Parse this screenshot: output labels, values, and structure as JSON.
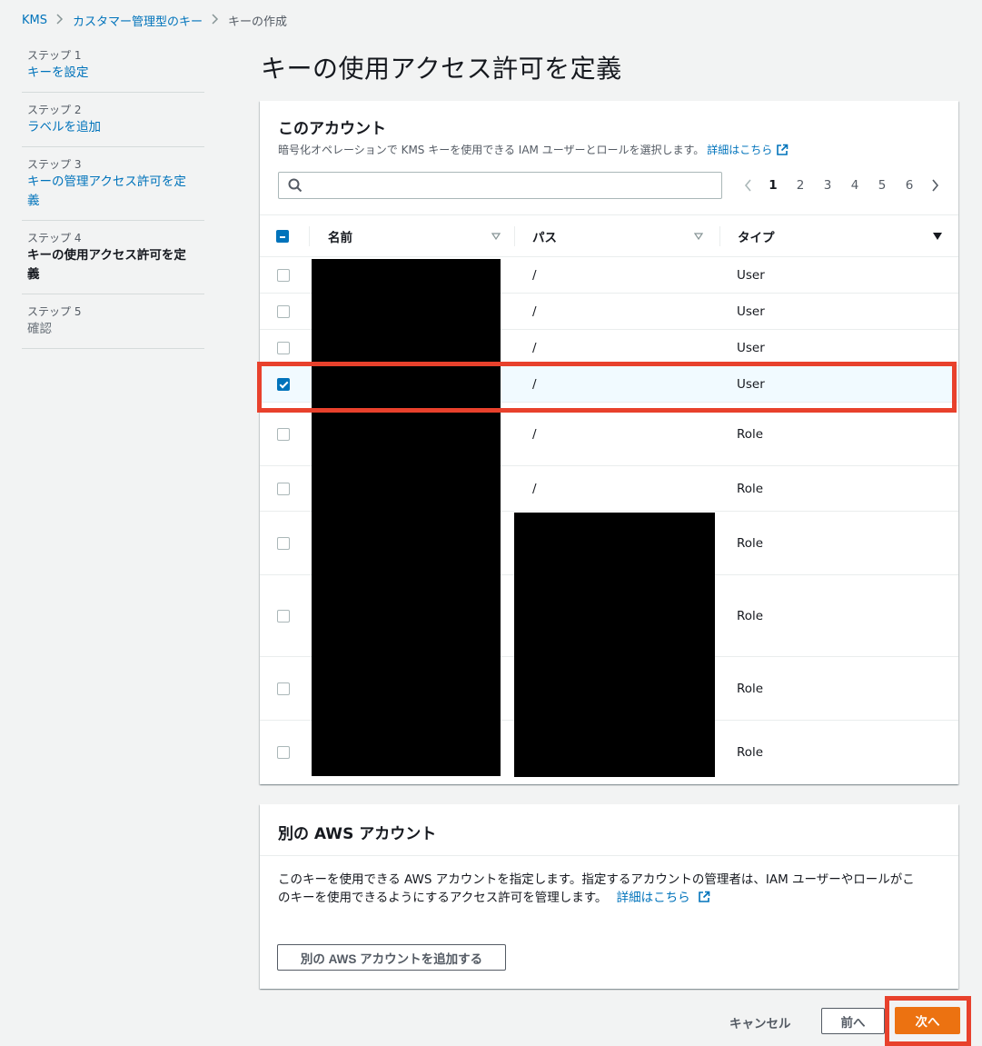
{
  "breadcrumb": {
    "items": [
      "KMS",
      "カスタマー管理型のキー"
    ],
    "current": "キーの作成"
  },
  "steps": [
    {
      "num": "ステップ 1",
      "label": "キーを設定",
      "state": "link"
    },
    {
      "num": "ステップ 2",
      "label": "ラベルを追加",
      "state": "link"
    },
    {
      "num": "ステップ 3",
      "label": "キーの管理アクセス許可を定義",
      "label_line2": "義",
      "label_line1": "キーの管理アクセス許可を定",
      "state": "link"
    },
    {
      "num": "ステップ 4",
      "label_line1": "キーの使用アクセス許可を定",
      "label_line2": "義",
      "state": "current"
    },
    {
      "num": "ステップ 5",
      "label": "確認",
      "state": "disabled"
    }
  ],
  "page_title": "キーの使用アクセス許可を定義",
  "this_account": {
    "title": "このアカウント",
    "description": "暗号化オペレーションで KMS キーを使用できる IAM ユーザーとロールを選択します。",
    "learn_more": "詳細はこちら",
    "search_placeholder": "",
    "pagination": {
      "pages": [
        "1",
        "2",
        "3",
        "4",
        "5",
        "6"
      ],
      "current": "1"
    },
    "columns": {
      "name": "名前",
      "path": "パス",
      "type": "タイプ"
    },
    "rows": [
      {
        "path": "/",
        "type": "User",
        "checked": false
      },
      {
        "path": "/",
        "type": "User",
        "checked": false
      },
      {
        "path": "/",
        "type": "User",
        "checked": false
      },
      {
        "path": "/",
        "type": "User",
        "checked": true
      },
      {
        "path": "/",
        "type": "Role",
        "checked": false
      },
      {
        "path": "/",
        "type": "Role",
        "checked": false
      },
      {
        "path": "",
        "type": "Role",
        "checked": false
      },
      {
        "path": "",
        "type": "Role",
        "checked": false
      },
      {
        "path": "",
        "type": "Role",
        "checked": false
      },
      {
        "path": "",
        "type": "Role",
        "checked": false
      }
    ]
  },
  "other_account": {
    "title": "別の AWS アカウント",
    "desc_line1": "このキーを使用できる AWS アカウントを指定します。指定するアカウントの管理者は、IAM ユーザーやロールがこ",
    "desc_line2": "のキーを使用できるようにするアクセス許可を管理します。",
    "learn_more": "詳細はこちら",
    "add_button": "別の AWS アカウントを追加する"
  },
  "footer": {
    "cancel": "キャンセル",
    "previous": "前へ",
    "next": "次へ"
  },
  "colors": {
    "link": "#0073bb",
    "primary": "#ec7211",
    "highlight": "#e8412c"
  }
}
